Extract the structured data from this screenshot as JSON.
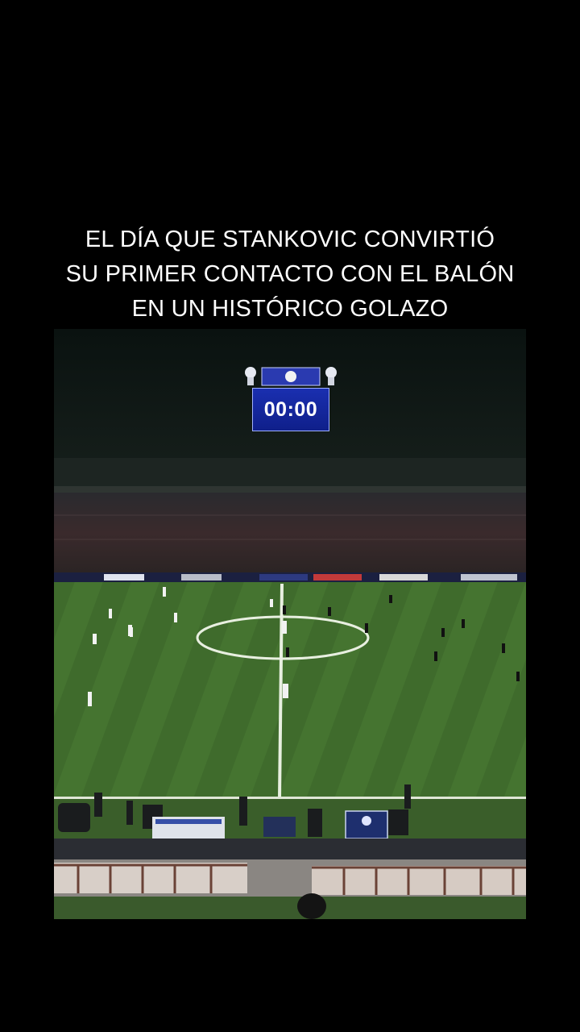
{
  "caption": {
    "line1": "EL DÍA QUE STANKOVIC CONVIRTIÓ",
    "line2": "SU PRIMER CONTACTO CON EL BALÓN",
    "line3": "EN UN HISTÓRICO GOLAZO"
  },
  "video": {
    "scoreboard_time": "00:00",
    "pitch_color": "#3e6a2c",
    "background_color": "#000000"
  }
}
